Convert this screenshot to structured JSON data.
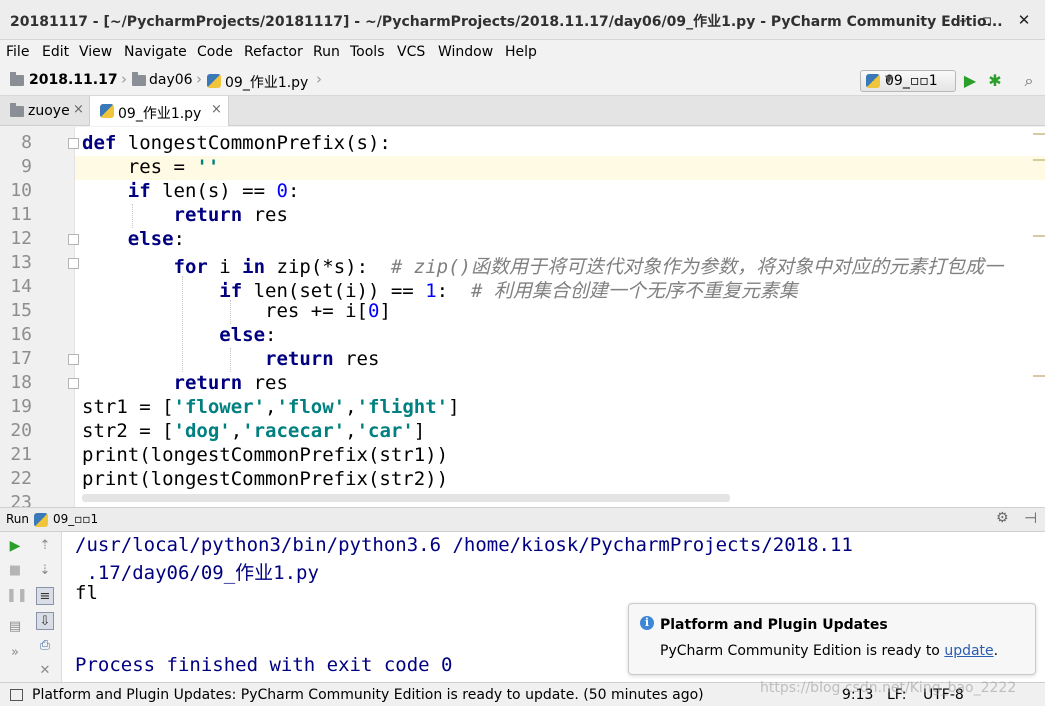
{
  "window": {
    "title": "20181117 - [~/PycharmProjects/20181117] - ~/PycharmProjects/2018.11.17/day06/09_作业1.py - PyCharm Community Editio...",
    "minimize": "–",
    "maximize": "▫",
    "close": "✕"
  },
  "menu": [
    "File",
    "Edit",
    "View",
    "Navigate",
    "Code",
    "Refactor",
    "Run",
    "Tools",
    "VCS",
    "Window",
    "Help"
  ],
  "breadcrumb": {
    "project": "2018.11.17",
    "folder": "day06",
    "file": "09_作业1.py"
  },
  "toolbar": {
    "run_config": "09_▫▫1",
    "run_icon": "play-icon",
    "debug_icon": "bug-icon",
    "search_icon": "search-icon"
  },
  "tabs": [
    {
      "label": "zuoye",
      "close": "×"
    },
    {
      "label": "09_作业1.py",
      "close": "×"
    }
  ],
  "editor": {
    "lines": [
      8,
      9,
      10,
      11,
      12,
      13,
      14,
      15,
      16,
      17,
      18,
      19,
      20,
      21,
      22,
      23
    ],
    "code": [
      {
        "k1": "def",
        "t1": " longestCommonPrefix(s):"
      },
      {
        "t1": "    res = ",
        "s1": "''"
      },
      {
        "k1": "    if",
        "t1": " len(s) == ",
        "n1": "0",
        "t2": ":"
      },
      {
        "k1": "        return",
        "t1": " res"
      },
      {
        "k1": "    else",
        "t1": ":"
      },
      {
        "k1": "        for",
        "t1": " i ",
        "k2": "in",
        "t2": " zip(*s):  ",
        "c1": "# zip()函数用于将可迭代对象作为参数，将对象中对应的元素打包成一"
      },
      {
        "k1": "            if",
        "t1": " len(set(i)) == ",
        "n1": "1",
        "t2": ":  ",
        "c1": "# 利用集合创建一个无序不重复元素集"
      },
      {
        "t1": "                res += i[",
        "n1": "0",
        "t2": "]"
      },
      {
        "k1": "            else",
        "t1": ":"
      },
      {
        "k1": "                return",
        "t1": " res"
      },
      {
        "k1": "        return",
        "t1": " res"
      },
      {
        "t1": "str1 = [",
        "s1": "'flower'",
        "t2": ",",
        "s2": "'flow'",
        "t3": ",",
        "s3": "'flight'",
        "t4": "]"
      },
      {
        "t1": "str2 = [",
        "s1": "'dog'",
        "t2": ",",
        "s2": "'racecar'",
        "t3": ",",
        "s3": "'car'",
        "t4": "]"
      },
      {
        "t1": "print(longestCommonPrefix(str1))"
      },
      {
        "t1": "print(longestCommonPrefix(str2))"
      }
    ]
  },
  "run_panel": {
    "header_label": "Run",
    "config": "09_▫▫1",
    "output": [
      "/usr/local/python3/bin/python3.6 /home/kiosk/PycharmProjects/2018.11",
      " .17/day06/09_作业1.py",
      "fl",
      "",
      "Process finished with exit code 0"
    ]
  },
  "notification": {
    "title": "Platform and Plugin Updates",
    "body": "PyCharm Community Edition is ready to ",
    "link": "update",
    "after": "."
  },
  "statusbar": {
    "message": "Platform and Plugin Updates: PyCharm Community Edition is ready to update. (50 minutes ago)",
    "position": "9:13",
    "line_sep": "LF:",
    "encoding": "UTF-8"
  },
  "watermark": "https://blog.csdn.net/King_bao_2222"
}
